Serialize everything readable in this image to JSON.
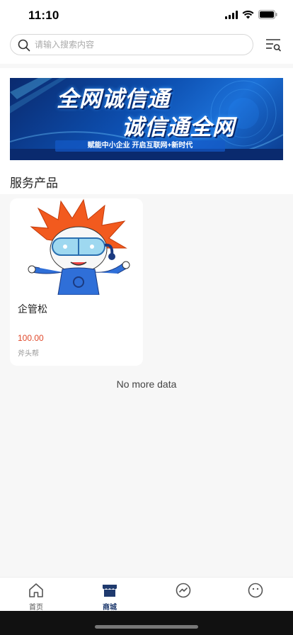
{
  "status": {
    "time": "11:10"
  },
  "search": {
    "placeholder": "请输入搜索内容"
  },
  "banner": {
    "title_line1": "全网诚信通",
    "title_line2": "诚信通全网",
    "subtitle": "赋能中小企业 开启互联网+新时代"
  },
  "section": {
    "title": "服务产品"
  },
  "products": [
    {
      "name": "企管松",
      "price": "100.00",
      "shop": "斧头帮"
    }
  ],
  "list_footer": "No more data",
  "tabbar": {
    "tabs": [
      {
        "label": "首页",
        "icon": "home-icon"
      },
      {
        "label": "商城",
        "icon": "shop-icon"
      },
      {
        "label": "",
        "icon": "chart-icon"
      },
      {
        "label": "",
        "icon": "face-icon"
      }
    ],
    "active_color": "#1f3a6e"
  }
}
